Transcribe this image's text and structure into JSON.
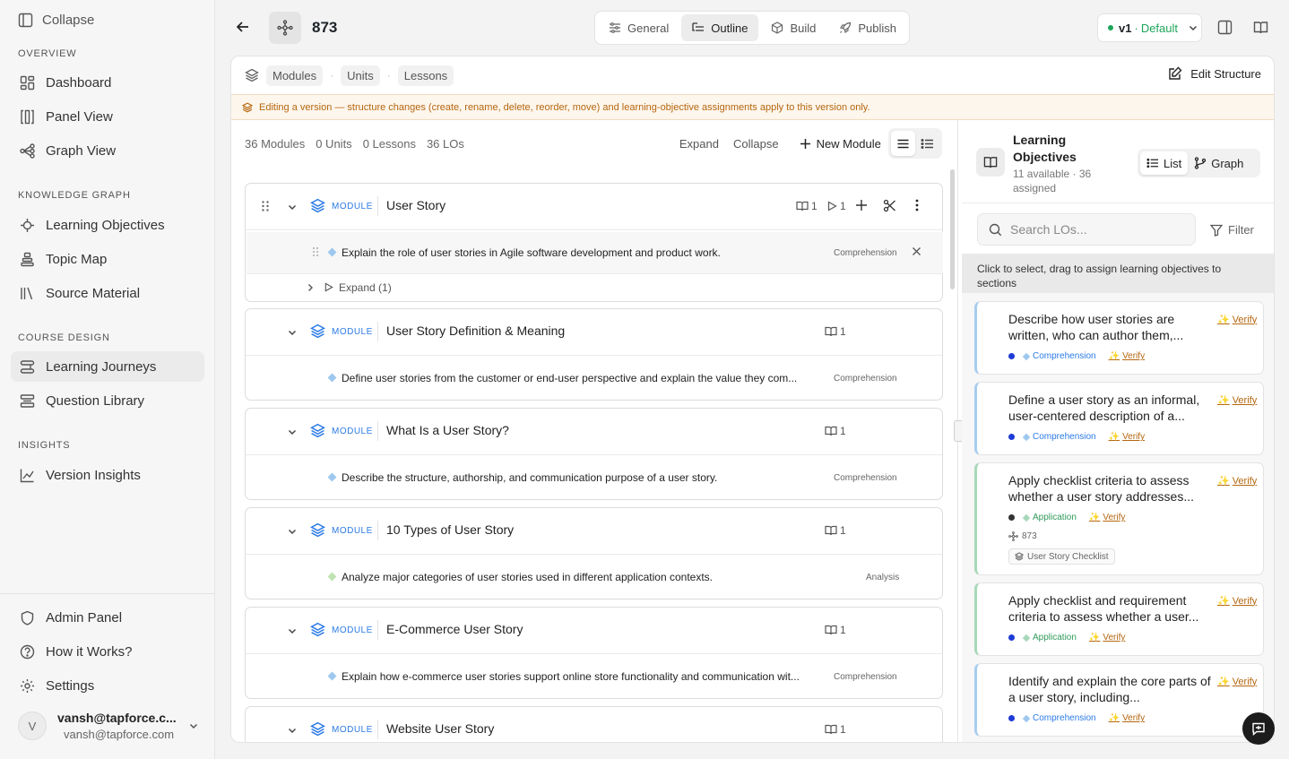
{
  "sidebar": {
    "collapse_label": "Collapse",
    "sections": {
      "overview": "OVERVIEW",
      "knowledge_graph": "KNOWLEDGE GRAPH",
      "course_design": "COURSE DESIGN",
      "insights": "INSIGHTS"
    },
    "items": {
      "dashboard": "Dashboard",
      "panel_view": "Panel View",
      "graph_view": "Graph View",
      "learning_objectives": "Learning Objectives",
      "topic_map": "Topic Map",
      "source_material": "Source Material",
      "learning_journeys": "Learning Journeys",
      "question_library": "Question Library",
      "version_insights": "Version Insights",
      "admin_panel": "Admin Panel",
      "how_it_works": "How it Works?",
      "settings": "Settings"
    },
    "user": {
      "initial": "V",
      "name": "vansh@tapforce.c...",
      "email": "vansh@tapforce.com"
    }
  },
  "header": {
    "title": "873",
    "tabs": {
      "general": "General",
      "outline": "Outline",
      "build": "Build",
      "publish": "Publish"
    },
    "active_tab": "Outline",
    "version": {
      "label": "v1",
      "separator": "·",
      "name": "Default"
    }
  },
  "breadcrumb": {
    "modules": "Modules",
    "units": "Units",
    "lessons": "Lessons"
  },
  "edit_structure_label": "Edit Structure",
  "notice": "Editing a version — structure changes (create, rename, delete, reorder, move) and learning-objective assignments apply to this version only.",
  "stats": {
    "modules": "36 Modules",
    "units": "0 Units",
    "lessons": "0 Lessons",
    "los": "36 LOs"
  },
  "toolbar": {
    "expand": "Expand",
    "collapse": "Collapse",
    "new_module": "New Module"
  },
  "modules": [
    {
      "tag": "MODULE",
      "title": "User Story",
      "lo_count": "1",
      "child_count": "1",
      "lo": "Explain the role of user stories in Agile software development and product work.",
      "bloom": "Comprehension",
      "expand_label": "Expand (1)"
    },
    {
      "tag": "MODULE",
      "title": "User Story Definition & Meaning",
      "lo_count": "1",
      "lo": "Define user stories from the customer or end-user perspective and explain the value they com...",
      "bloom": "Comprehension"
    },
    {
      "tag": "MODULE",
      "title": "What Is a User Story?",
      "lo_count": "1",
      "lo": "Describe the structure, authorship, and communication purpose of a user story.",
      "bloom": "Comprehension"
    },
    {
      "tag": "MODULE",
      "title": "10 Types of User Story",
      "lo_count": "1",
      "lo": "Analyze major categories of user stories used in different application contexts.",
      "bloom": "Analysis"
    },
    {
      "tag": "MODULE",
      "title": "E-Commerce User Story",
      "lo_count": "1",
      "lo": "Explain how e-commerce user stories support online store functionality and communication wit...",
      "bloom": "Comprehension"
    },
    {
      "tag": "MODULE",
      "title": "Website User Story",
      "lo_count": "1"
    }
  ],
  "lo_panel": {
    "title": "Learning Objectives",
    "subtitle": "11 available · 36 assigned",
    "list_label": "List",
    "graph_label": "Graph",
    "search_placeholder": "Search LOs...",
    "filter_label": "Filter",
    "hint": "Click to select, drag to assign learning objectives to sections",
    "cards": [
      {
        "title": "Describe how user stories are written, who can author them,...",
        "verify": "Verify",
        "bloom": "Comprehension",
        "verify2": "Verify"
      },
      {
        "title": "Define a user story as an informal, user-centered description of a...",
        "verify": "Verify",
        "bloom": "Comprehension",
        "verify2": "Verify"
      },
      {
        "title": "Apply checklist criteria to assess whether a user story addresses...",
        "verify": "Verify",
        "bloom": "Application",
        "verify2": "Verify",
        "project": "873",
        "chip": "User Story Checklist"
      },
      {
        "title": "Apply checklist and requirement criteria to assess whether a user...",
        "verify": "Verify",
        "bloom": "Application",
        "verify2": "Verify"
      },
      {
        "title": "Identify and explain the core parts of a user story, including...",
        "verify": "Verify",
        "bloom": "Comprehension",
        "verify2": "Verify"
      }
    ]
  },
  "colors": {
    "accent_blue": "#2c7be5",
    "warning": "#b5660f",
    "success": "#1fa55a",
    "application_green": "#2f9a5b"
  }
}
